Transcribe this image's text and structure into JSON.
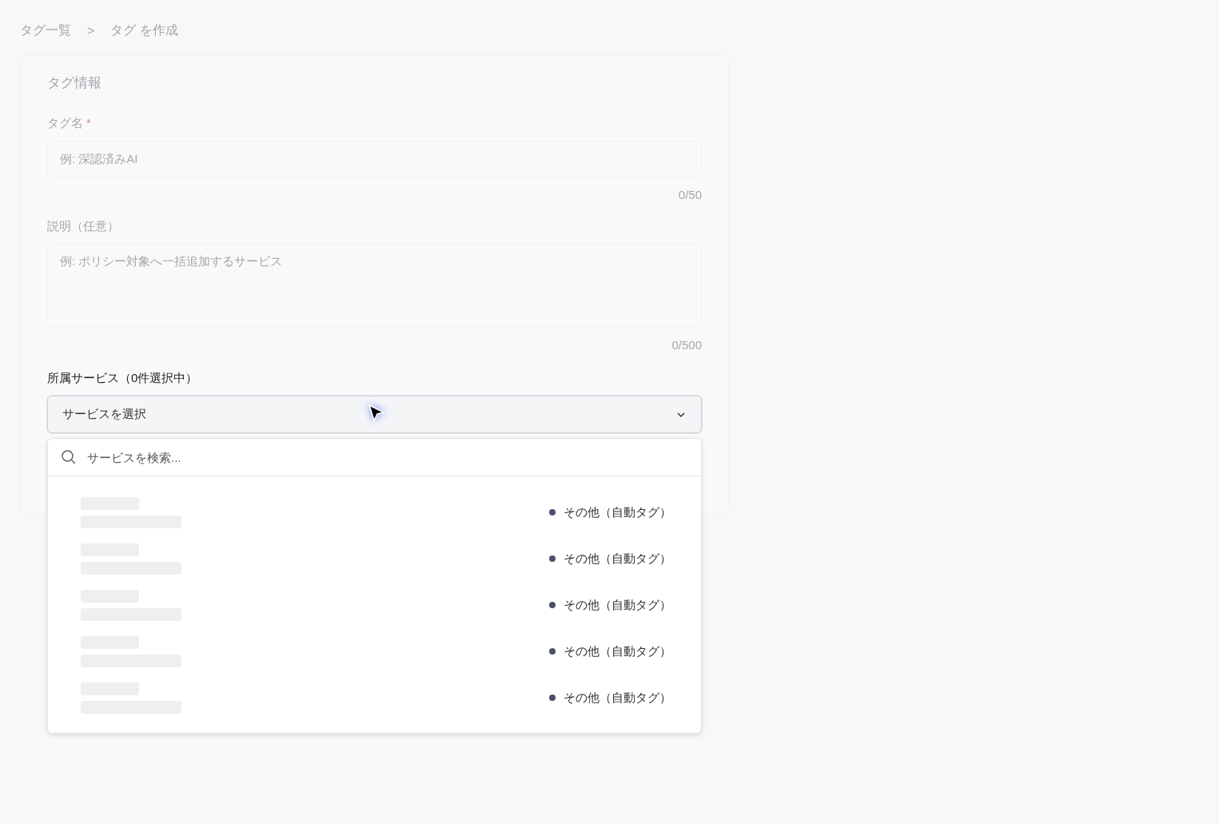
{
  "breadcrumb": [
    {
      "label": "タグ一覧"
    },
    {
      "label": "タグ を作成"
    }
  ],
  "breadcrumb_separator": ">",
  "card": {
    "title": "タグ情報",
    "name_field": {
      "label": "タグ名",
      "required_mark": "*",
      "placeholder": "例: 深認済みAI",
      "counter": "0/50"
    },
    "description_field": {
      "label": "説明（任意）",
      "placeholder": "例: ポリシー対象へ一括追加するサービス",
      "counter": "0/500"
    },
    "services_field": {
      "label": "所属サービス（0件選択中）",
      "placeholder": "サービスを選択",
      "expanded": true
    }
  },
  "dropdown": {
    "search_placeholder": "サービスを検索...",
    "loading": true,
    "options": [
      {
        "tag": "その他（自動タグ）"
      },
      {
        "tag": "その他（自動タグ）"
      },
      {
        "tag": "その他（自動タグ）"
      },
      {
        "tag": "その他（自動タグ）"
      },
      {
        "tag": "その他（自動タグ）"
      }
    ]
  }
}
